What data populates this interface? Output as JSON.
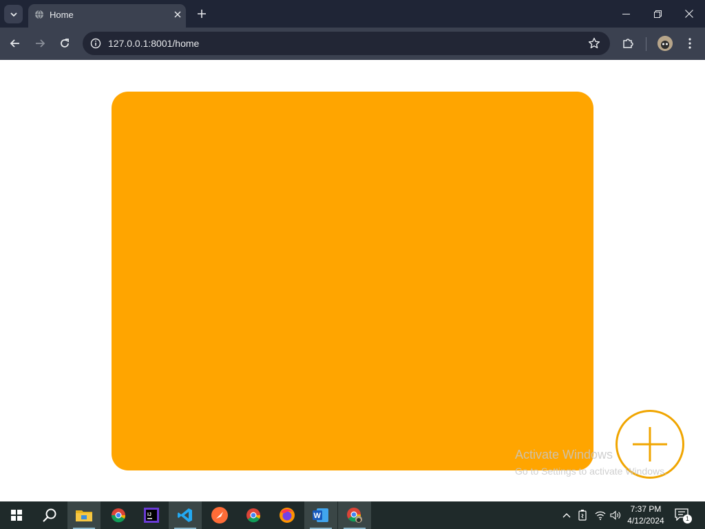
{
  "browser": {
    "tab": {
      "title": "Home",
      "favicon": "globe-icon"
    },
    "new_tab_icon": "plus-icon",
    "address_bar": {
      "url": "127.0.0.1:8001/home"
    },
    "icons": {
      "back": "arrow-left-icon",
      "forward": "arrow-right-icon",
      "reload": "reload-icon",
      "site_info": "info-icon",
      "bookmark": "star-icon",
      "extensions": "puzzle-icon",
      "profile": "avatar",
      "menu": "kebab-menu-icon"
    }
  },
  "page": {
    "card_color": "#FFA500",
    "fab_color": "#F0A500",
    "fab_icon": "plus-icon"
  },
  "watermark": {
    "line1": "Activate Windows",
    "line2": "Go to Settings to activate Windows."
  },
  "taskbar": {
    "apps": [
      "start-icon",
      "search-icon",
      "file-explorer-icon",
      "chrome-icon",
      "intellij-icon",
      "vscode-icon",
      "postman-icon",
      "chrome-icon",
      "firefox-icon",
      "word-icon",
      "chrome-icon"
    ],
    "clock": {
      "time": "7:37 PM",
      "date": "4/12/2024"
    },
    "notification_count": "1"
  },
  "colors": {
    "tab_strip": "#1F2536",
    "toolbar": "#3B4150",
    "taskbar": "#1F2A2A"
  }
}
